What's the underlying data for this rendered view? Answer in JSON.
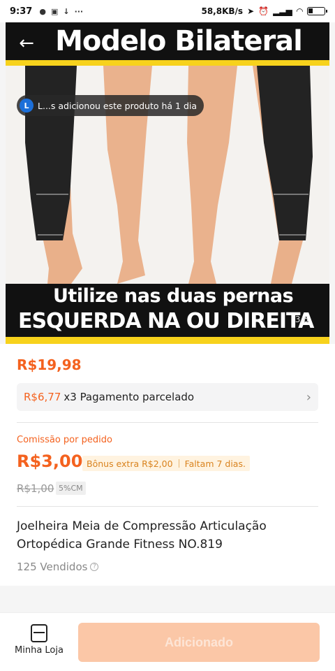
{
  "status_bar": {
    "time": "9:37",
    "network_speed": "58,8KB/s"
  },
  "hero": {
    "title": "Modelo Bilateral",
    "caption_line1": "Utilize nas duas pernas",
    "caption_line2": "ESQUERDA NA OU DIREITA",
    "page_counter": "3/6",
    "toast": {
      "avatar_letter": "L",
      "text": "L...s adicionou este produto há 1 dia"
    }
  },
  "product": {
    "price": "R$19,98",
    "installment": {
      "amount": "R$6,77",
      "text": "x3 Pagamento parcelado"
    },
    "commission": {
      "label": "Comissão por pedido",
      "value": "R$3,00",
      "bonus": "Bônus extra R$2,00",
      "remaining": "Faltam 7 dias.",
      "old_value": "R$1,00",
      "rate": "5%CM"
    },
    "title": "Joelheira Meia de Compressão Articulação Ortopédica Grande Fitness NO.819",
    "sold": "125 Vendidos"
  },
  "bottom_bar": {
    "store_label": "Minha Loja",
    "added_label": "Adicionado"
  },
  "colors": {
    "accent": "#f4621f",
    "banner_yellow": "#f7d21c",
    "button_disabled": "#fbc7a7"
  }
}
